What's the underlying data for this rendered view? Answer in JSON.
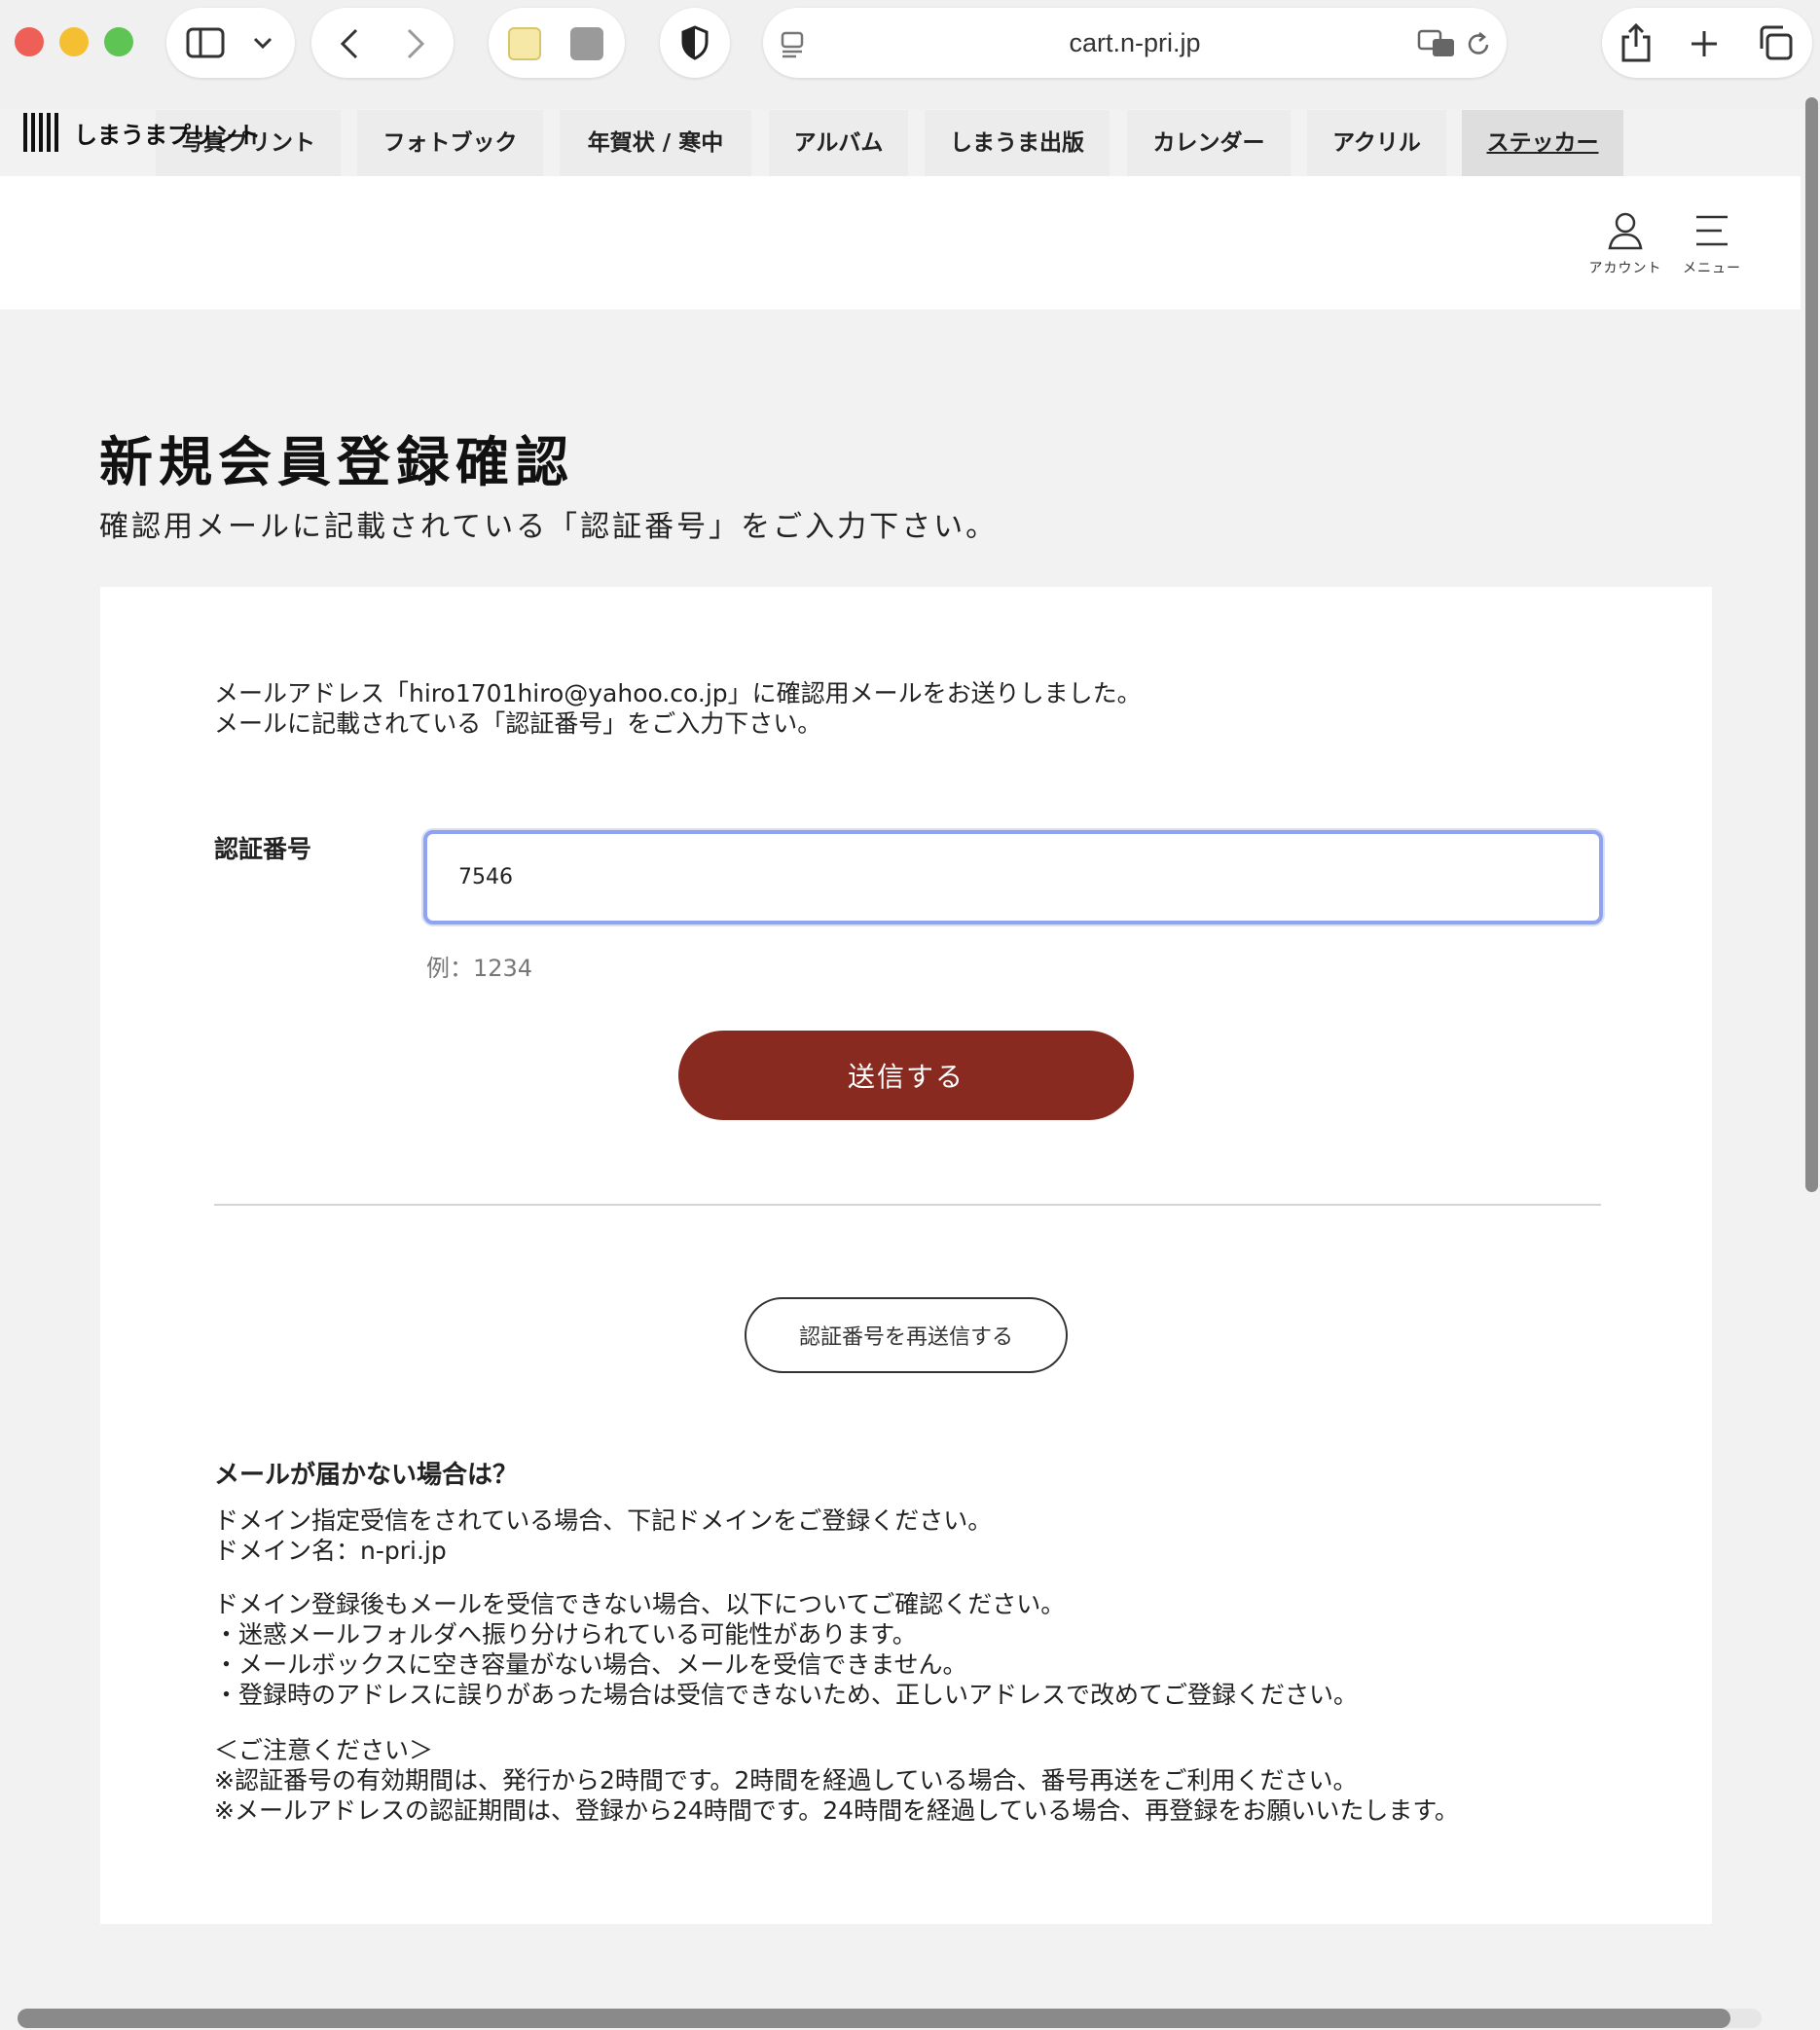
{
  "browser": {
    "url": "cart.n-pri.jp"
  },
  "site": {
    "logo_text": "しまうまプリント",
    "nav_tabs": [
      {
        "label": "写真プリント"
      },
      {
        "label": "フォトブック"
      },
      {
        "label": "年賀状 / 寒中"
      },
      {
        "label": "アルバム"
      },
      {
        "label": "しまうま出版"
      },
      {
        "label": "カレンダー"
      },
      {
        "label": "アクリル"
      },
      {
        "label": "ステッカー"
      }
    ],
    "account_label": "アカウント",
    "menu_label": "メニュー"
  },
  "page": {
    "title": "新規会員登録確認",
    "subtitle": "確認用メールに記載されている「認証番号」をご入力下さい。"
  },
  "form": {
    "intro_line1": "メールアドレス「hiro1701hiro@yahoo.co.jp」に確認用メールをお送りしました。",
    "intro_line2": "メールに記載されている「認証番号」をご入力下さい。",
    "code_label": "認証番号",
    "code_value": "7546",
    "code_hint": "例：1234",
    "submit_label": "送信する",
    "resend_label": "認証番号を再送信する"
  },
  "help": {
    "title": "メールが届かない場合は？",
    "block1": [
      "ドメイン指定受信をされている場合、下記ドメインをご登録ください。",
      "ドメイン名：n-pri.jp"
    ],
    "block2": [
      "ドメイン登録後もメールを受信できない場合、以下についてご確認ください。",
      "・迷惑メールフォルダへ振り分けられている可能性があります。",
      "・メールボックスに空き容量がない場合、メールを受信できません。",
      "・登録時のアドレスに誤りがあった場合は受信できないため、正しいアドレスで改めてご登録ください。"
    ],
    "block3": [
      "＜ご注意ください＞",
      "※認証番号の有効期間は、発行から2時間です。2時間を経過している場合、番号再送をご利用ください。",
      "※メールアドレスの認証期間は、登録から24時間です。24時間を経過している場合、再登録をお願いいたします。"
    ]
  },
  "colors": {
    "submit_bg": "#882a20",
    "input_focus": "#8fa3ef",
    "page_bg": "#f2f2f2"
  },
  "icons": [
    "sidebar-icon",
    "chevron-down-icon",
    "back-icon",
    "forward-icon",
    "shield-icon",
    "page-icon",
    "translate-icon",
    "reload-icon",
    "share-icon",
    "new-tab-icon",
    "tabs-overview-icon",
    "account-icon",
    "menu-icon"
  ]
}
